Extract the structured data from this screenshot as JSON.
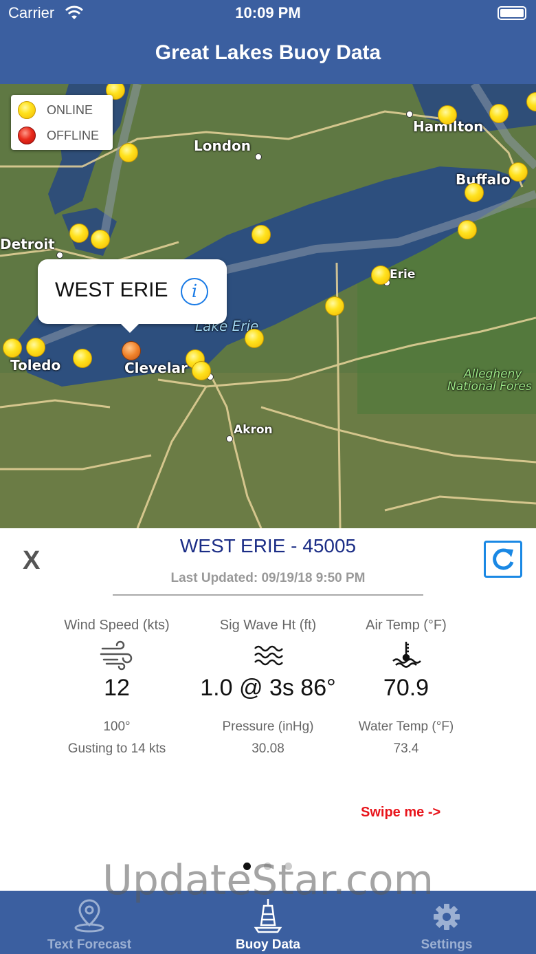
{
  "status_bar": {
    "carrier": "Carrier",
    "time": "10:09 PM"
  },
  "nav": {
    "title": "Great Lakes Buoy Data"
  },
  "legend": {
    "online": "ONLINE",
    "offline": "OFFLINE"
  },
  "map": {
    "labels": {
      "london": "London",
      "hamilton": "Hamilton",
      "buffalo": "Buffalo",
      "detroit": "Detroit",
      "erie": "Erie",
      "toledo": "Toledo",
      "cleveland": "Clevelar",
      "lake_erie": "Lake Erie",
      "akron": "Akron",
      "allegheny_1": "Allegheny",
      "allegheny_2": "National Fores"
    },
    "callout": {
      "name": "WEST ERIE"
    }
  },
  "station": {
    "title": "WEST ERIE - 45005",
    "last_updated": "Last Updated: 09/19/18 9:50 PM",
    "close_label": "X",
    "wind": {
      "label": "Wind Speed (kts)",
      "value": "12",
      "direction": "100°",
      "gust": "Gusting to 14 kts"
    },
    "wave": {
      "label": "Sig Wave Ht (ft)",
      "value": "1.0 @ 3s 86°",
      "pressure_label": "Pressure (inHg)",
      "pressure": "30.08"
    },
    "air": {
      "label": "Air Temp (°F)",
      "value": "70.9",
      "water_label": "Water Temp (°F)",
      "water": "73.4"
    },
    "swipe": "Swipe me ->"
  },
  "watermark": "UpdateStar.com",
  "tabs": [
    {
      "label": "Text Forecast",
      "icon": "location-pin-icon"
    },
    {
      "label": "Buoy Data",
      "icon": "buoy-icon"
    },
    {
      "label": "Settings",
      "icon": "gear-icon"
    }
  ],
  "colors": {
    "nav": "#3b5fa0",
    "title": "#1b2d86",
    "swipe": "#e8141b",
    "refresh": "#1a88e4"
  }
}
